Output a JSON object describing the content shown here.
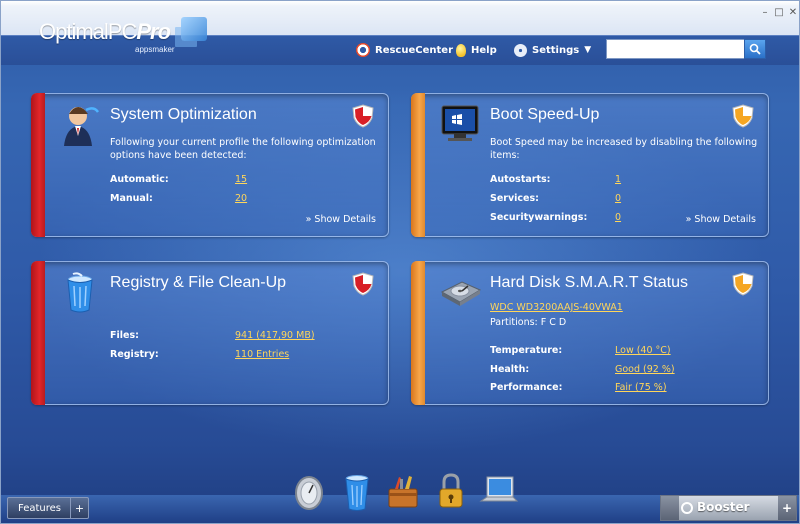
{
  "app": {
    "logo_main": "OptimalPC",
    "logo_bold": "Pro",
    "logo_sub": "appsmaker"
  },
  "window_controls": {
    "minimize": "–",
    "maximize": "□",
    "close": "✕"
  },
  "nav": {
    "rescue": "RescueCenter",
    "help": "Help",
    "settings": "Settings"
  },
  "search": {
    "value": "",
    "placeholder": ""
  },
  "panels": {
    "sysopt": {
      "title": "System Optimization",
      "description": "Following your current profile the following optimization options have been detected:",
      "rows": [
        {
          "label": "Automatic:",
          "value": "15"
        },
        {
          "label": "Manual:",
          "value": "20"
        }
      ],
      "details": "» Show Details"
    },
    "boot": {
      "title": "Boot Speed-Up",
      "description": "Boot Speed may be increased by disabling the following items:",
      "rows": [
        {
          "label": "Autostarts:",
          "value": "1"
        },
        {
          "label": "Services:",
          "value": "0"
        },
        {
          "label": "Securitywarnings:",
          "value": "0"
        }
      ],
      "details": "» Show Details"
    },
    "registry": {
      "title": "Registry & File Clean-Up",
      "rows": [
        {
          "label": "Files:",
          "value": "941 (417,90 MB)"
        },
        {
          "label": "Registry:",
          "value": "110 Entries"
        }
      ]
    },
    "harddisk": {
      "title": "Hard Disk S.M.A.R.T Status",
      "drive": "WDC WD3200AAJS-40VWA1",
      "partitions": "Partitions: F C D",
      "rows": [
        {
          "label": "Temperature:",
          "value": "Low (40 °C)"
        },
        {
          "label": "Health:",
          "value": "Good (92 %)"
        },
        {
          "label": "Performance:",
          "value": "Fair (75 %)"
        }
      ]
    }
  },
  "bottom": {
    "features": "Features",
    "features_toggle": "+",
    "booster": "Booster",
    "booster_toggle": "+"
  },
  "colors": {
    "accent_value": "#ffd65a",
    "stripe_red": "#e2262a",
    "stripe_orange": "#f7a64a"
  }
}
